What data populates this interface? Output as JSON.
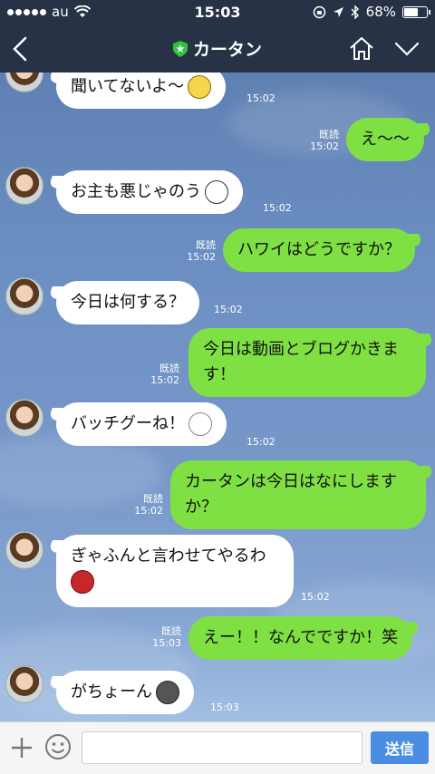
{
  "status": {
    "carrier": "au",
    "time": "15:03",
    "battery": "68%",
    "battery_level": 0.68
  },
  "header": {
    "title": "カータン"
  },
  "messages": [
    {
      "side": "in",
      "text": "聞いてないよ～",
      "time": "15:02",
      "sticker": "yellow-face"
    },
    {
      "side": "out",
      "text": "え～～",
      "read": "既読",
      "time": "15:02"
    },
    {
      "side": "in",
      "text": "お主も悪じゃのう",
      "time": "15:02",
      "sticker": "grin-face"
    },
    {
      "side": "out",
      "text": "ハワイはどうですか？",
      "read": "既読",
      "time": "15:02"
    },
    {
      "side": "in",
      "text": "今日は何する？",
      "time": "15:02"
    },
    {
      "side": "out",
      "text": "今日は動画とブログかきま\nす！",
      "read": "既読",
      "time": "15:02"
    },
    {
      "side": "in",
      "text": "バッチグーね！",
      "time": "15:02",
      "sticker": "bunny-face"
    },
    {
      "side": "out",
      "text": "カータンは今日はなにしますか？",
      "read": "既読",
      "time": "15:02"
    },
    {
      "side": "in",
      "text": "ぎゃふんと言わせてやるわ",
      "time": "15:02",
      "sticker": "angry-face"
    },
    {
      "side": "out",
      "text": "えー！！なんでですか！笑",
      "read": "既読",
      "time": "15:03"
    },
    {
      "side": "in",
      "text": "がちょーん",
      "time": "15:03",
      "sticker": "shock-face"
    }
  ],
  "input": {
    "placeholder": "",
    "send_label": "送信"
  }
}
